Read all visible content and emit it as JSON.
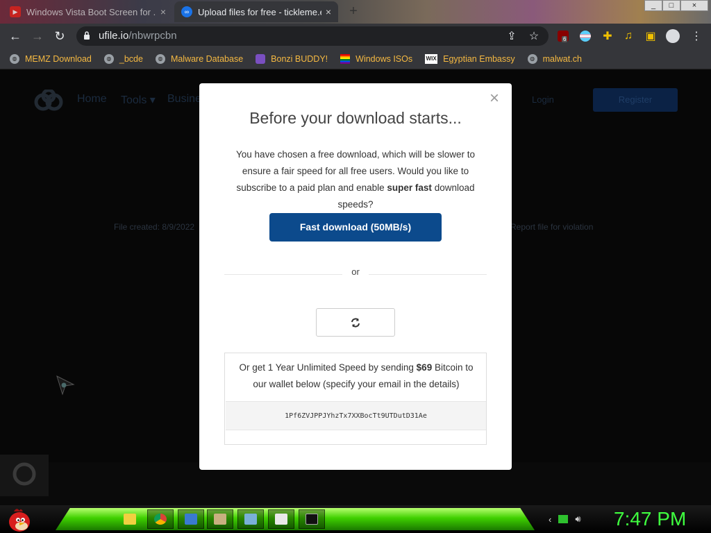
{
  "browser": {
    "tabs": [
      {
        "title": "Windows Vista Boot Screen for ...",
        "icon": "youtube-icon",
        "active": false
      },
      {
        "title": "Upload files for free - tickleme.ex",
        "icon": "ufile-icon",
        "active": true
      }
    ],
    "new_tab_symbol": "+",
    "window_buttons": [
      "_",
      "□",
      "×"
    ],
    "url_domain": "ufile.io",
    "url_path": "/nbwrpcbn",
    "extension_badge": "6"
  },
  "bookmarks": [
    {
      "label": "MEMZ Download",
      "icon": "globe-icon"
    },
    {
      "label": "_bcde",
      "icon": "globe-icon"
    },
    {
      "label": "Malware Database",
      "icon": "globe-icon"
    },
    {
      "label": "Bonzi BUDDY!",
      "icon": "bonzi-icon"
    },
    {
      "label": "Windows ISOs",
      "icon": "rainbow-flag-icon"
    },
    {
      "label": "Egyptian Embassy",
      "icon": "wix-icon"
    },
    {
      "label": "malwat.ch",
      "icon": "globe-icon"
    }
  ],
  "site": {
    "nav": [
      "Home",
      "Tools ▾",
      "Busine"
    ],
    "login": "Login",
    "register": "Register",
    "file_created": "File created: 8/9/2022",
    "report": "Report file for violation"
  },
  "modal": {
    "close": "×",
    "title": "Before your download starts...",
    "desc_part1": "You have chosen a free download, which will be slower to ensure a fair speed for all free users. Would you like to subscribe to a paid plan and enable ",
    "desc_bold": "super fast",
    "desc_part2": " download speeds?",
    "fast_button": "Fast download (50MB/s)",
    "or": "or",
    "btc_part1": "Or get 1 Year Unlimited Speed by sending ",
    "btc_price": "$69",
    "btc_part2": " Bitcoin to our wallet below (specify your email in the details)",
    "btc_address": "1Pf6ZVJPPJYhzTx7XXBocTt9UTDutD31Ae",
    "primary_color": "#0c4a8c"
  },
  "taskbar": {
    "clock": "7:47 PM",
    "apps": [
      "explorer",
      "chrome",
      "app3",
      "app4",
      "app5",
      "app6",
      "cmd"
    ]
  }
}
